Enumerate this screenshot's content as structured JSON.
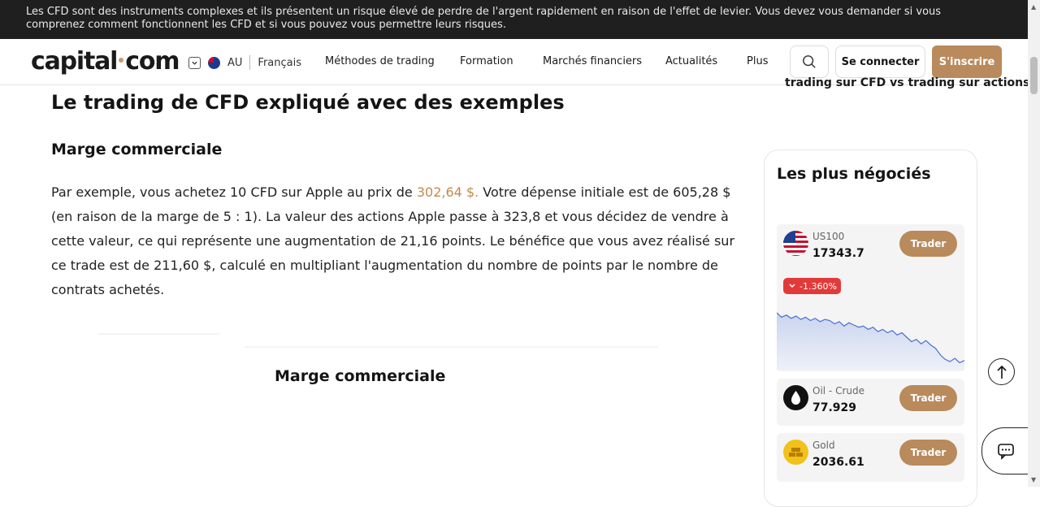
{
  "risk_banner": {
    "text": "Les CFD sont des instruments complexes et ils présentent un risque élevé de perdre de l'argent rapidement en raison de l'effet de levier. Vous devez vous demander si vous comprenez comment fonctionnent les CFD et si vous pouvez vous permettre leurs risques."
  },
  "header": {
    "logo_left": "capital",
    "logo_right": "com",
    "region": "AU",
    "language": "Français",
    "nav": [
      "Méthodes de trading",
      "Formation",
      "Marchés financiers",
      "Actualités",
      "Plus"
    ],
    "login": "Se connecter",
    "signup": "S'inscrire"
  },
  "article": {
    "title": "Le trading de CFD expliqué avec des exemples",
    "subtitle": "Marge commerciale",
    "para_prefix": "Par exemple, vous achetez 10 CFD sur Apple au prix de ",
    "para_price": "302,64 $.",
    "para_suffix": " Votre dépense initiale est de 605,28 $ (en raison de la marge de 5 : 1). La valeur des actions Apple passe à 323,8 et vous décidez de vendre à cette valeur, ce qui représente une augmentation de 21,16 points. Le bénéfice que vous avez réalisé sur ce trade est de 211,60 $, calculé en multipliant l'augmentation du nombre de points par le nombre de contrats achetés.",
    "image_title": "Marge commerciale"
  },
  "sidebar": {
    "toc_item": "trading sur CFD vs trading sur actions",
    "widget_title": "Les plus négociés",
    "instruments": [
      {
        "name": "US100",
        "value": "17343.7",
        "change": "-1.360%",
        "trade": "Trader",
        "icon": "us-flag-icon"
      },
      {
        "name": "Oil - Crude",
        "value": "77.929",
        "trade": "Trader",
        "icon": "oil-drop-icon"
      },
      {
        "name": "Gold",
        "value": "2036.61",
        "trade": "Trader",
        "icon": "gold-bars-icon"
      }
    ],
    "sparkline": [
      62,
      58,
      60,
      57,
      59,
      56,
      58,
      55,
      57,
      54,
      56,
      55,
      52,
      54,
      50,
      53,
      51,
      49,
      50,
      47,
      49,
      45,
      47,
      44,
      46,
      42,
      44,
      40,
      36,
      38,
      34,
      37,
      33,
      30,
      24,
      20,
      18,
      21,
      17,
      19
    ]
  },
  "colors": {
    "brand_gold": "#b98a5c",
    "price_highlight": "#c28a4f",
    "negative": "#e23a3a",
    "banner_bg": "#1f1f1f",
    "spark_line": "#4a6fd0"
  }
}
